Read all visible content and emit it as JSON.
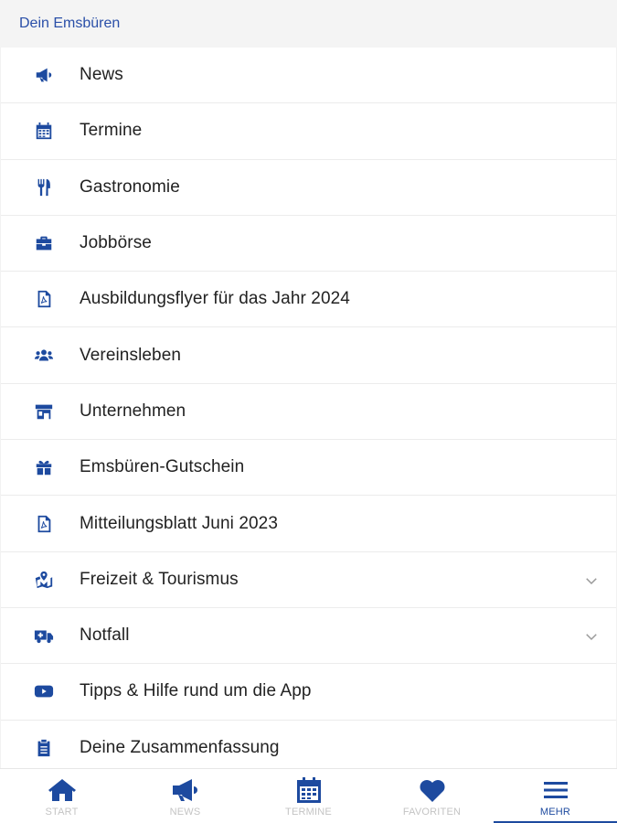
{
  "header": {
    "title": "Dein Emsbüren"
  },
  "menu": [
    {
      "label": "News",
      "icon": "megaphone-icon"
    },
    {
      "label": "Termine",
      "icon": "calendar-icon"
    },
    {
      "label": "Gastronomie",
      "icon": "utensils-icon"
    },
    {
      "label": "Jobbörse",
      "icon": "briefcase-icon"
    },
    {
      "label": "Ausbildungsflyer für das Jahr 2024",
      "icon": "pdf-file-icon"
    },
    {
      "label": "Vereinsleben",
      "icon": "users-icon"
    },
    {
      "label": "Unternehmen",
      "icon": "store-icon"
    },
    {
      "label": "Emsbüren-Gutschein",
      "icon": "gift-icon"
    },
    {
      "label": "Mitteilungsblatt Juni 2023",
      "icon": "pdf-file-icon"
    },
    {
      "label": "Freizeit & Tourismus",
      "icon": "map-marked-icon",
      "expandable": true
    },
    {
      "label": "Notfall",
      "icon": "ambulance-icon",
      "expandable": true
    },
    {
      "label": "Tipps & Hilfe rund um die App",
      "icon": "youtube-icon"
    },
    {
      "label": "Deine Zusammenfassung",
      "icon": "clipboard-icon"
    }
  ],
  "tabs": [
    {
      "label": "START",
      "icon": "home-icon"
    },
    {
      "label": "NEWS",
      "icon": "megaphone-icon"
    },
    {
      "label": "TERMINE",
      "icon": "calendar-icon"
    },
    {
      "label": "FAVORITEN",
      "icon": "heart-icon"
    },
    {
      "label": "MEHR",
      "icon": "menu-icon",
      "active": true
    }
  ],
  "colors": {
    "accent": "#1d4a9f",
    "inactive_tab": "#c4c4c4"
  }
}
